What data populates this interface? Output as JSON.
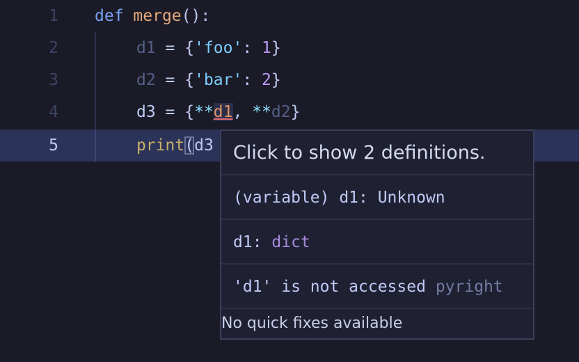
{
  "editor": {
    "current_line": "5",
    "lines": [
      {
        "number": "1",
        "tokens": [
          "def",
          " ",
          "merge",
          "():"
        ]
      },
      {
        "number": "2",
        "tokens": [
          "d1",
          " = {",
          "'foo'",
          ": ",
          "1",
          "}"
        ]
      },
      {
        "number": "3",
        "tokens": [
          "d2",
          " = {",
          "'bar'",
          ": ",
          "2",
          "}"
        ]
      },
      {
        "number": "4",
        "tokens": [
          "d3",
          " = {",
          "**",
          "d1",
          ", ",
          "**",
          "d2",
          "}"
        ]
      },
      {
        "number": "5",
        "tokens": [
          "print",
          "(",
          "d3"
        ]
      }
    ]
  },
  "hover": {
    "title": "Click to show 2 definitions.",
    "signature": "(variable) d1: Unknown",
    "type_label": "d1: ",
    "type_name": "dict",
    "diagnostic": "'d1' is not accessed",
    "diagnostic_source": "pyright",
    "quick_fix": "No quick fixes available"
  },
  "colors": {
    "background": "#1a1b26",
    "current_line_highlight": "#2c3359",
    "keyword": "#7aa2f7",
    "function": "#e8a87c",
    "string": "#9ece6a",
    "number": "#bb9af7",
    "tooltip_background": "#1f2133"
  }
}
